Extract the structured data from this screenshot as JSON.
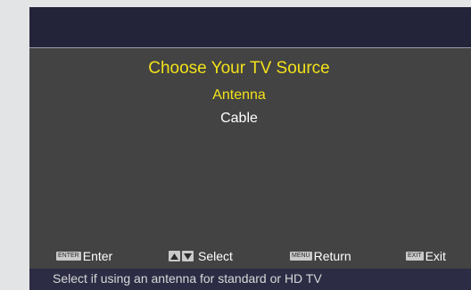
{
  "menu": {
    "title": "Choose Your TV Source",
    "options": [
      {
        "label": "Antenna",
        "selected": true
      },
      {
        "label": "Cable",
        "selected": false
      }
    ]
  },
  "legend": {
    "enter": {
      "key": "ENTER",
      "label": "Enter"
    },
    "select": {
      "icons": [
        "arrow-up-icon",
        "arrow-down-icon"
      ],
      "label": "Select"
    },
    "return": {
      "key": "MENU",
      "label": "Return"
    },
    "exit": {
      "key": "EXIT",
      "label": "Exit"
    }
  },
  "status": {
    "text": "Select if using an antenna for standard or HD TV"
  },
  "colors": {
    "page_background": "#e3e4e6",
    "screen_background": "#434343",
    "header_band": "#23233a",
    "highlight": "#f2e21a",
    "normal_text": "#ffffff",
    "status_bar": "#2c2c45",
    "key_badge": "#c9c9c9"
  }
}
